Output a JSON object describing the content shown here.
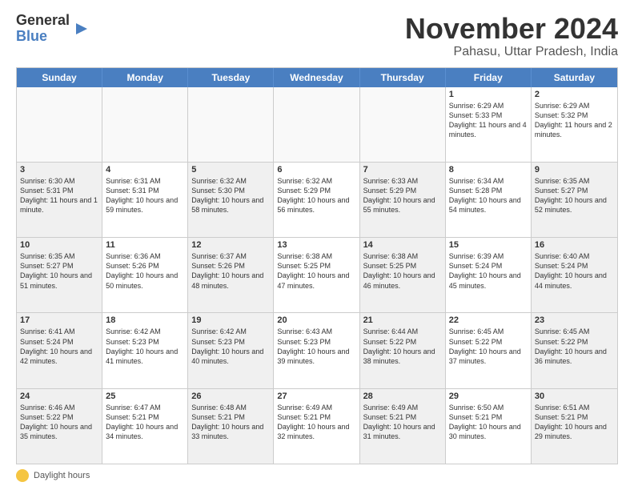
{
  "logo": {
    "line1": "General",
    "line2": "Blue"
  },
  "title": "November 2024",
  "subtitle": "Pahasu, Uttar Pradesh, India",
  "header_days": [
    "Sunday",
    "Monday",
    "Tuesday",
    "Wednesday",
    "Thursday",
    "Friday",
    "Saturday"
  ],
  "footer_label": "Daylight hours",
  "weeks": [
    [
      {
        "day": "",
        "info": "",
        "shaded": true
      },
      {
        "day": "",
        "info": "",
        "shaded": true
      },
      {
        "day": "",
        "info": "",
        "shaded": true
      },
      {
        "day": "",
        "info": "",
        "shaded": true
      },
      {
        "day": "",
        "info": "",
        "shaded": true
      },
      {
        "day": "1",
        "info": "Sunrise: 6:29 AM\nSunset: 5:33 PM\nDaylight: 11 hours and 4 minutes.",
        "shaded": false
      },
      {
        "day": "2",
        "info": "Sunrise: 6:29 AM\nSunset: 5:32 PM\nDaylight: 11 hours and 2 minutes.",
        "shaded": false
      }
    ],
    [
      {
        "day": "3",
        "info": "Sunrise: 6:30 AM\nSunset: 5:31 PM\nDaylight: 11 hours and 1 minute.",
        "shaded": true
      },
      {
        "day": "4",
        "info": "Sunrise: 6:31 AM\nSunset: 5:31 PM\nDaylight: 10 hours and 59 minutes.",
        "shaded": false
      },
      {
        "day": "5",
        "info": "Sunrise: 6:32 AM\nSunset: 5:30 PM\nDaylight: 10 hours and 58 minutes.",
        "shaded": true
      },
      {
        "day": "6",
        "info": "Sunrise: 6:32 AM\nSunset: 5:29 PM\nDaylight: 10 hours and 56 minutes.",
        "shaded": false
      },
      {
        "day": "7",
        "info": "Sunrise: 6:33 AM\nSunset: 5:29 PM\nDaylight: 10 hours and 55 minutes.",
        "shaded": true
      },
      {
        "day": "8",
        "info": "Sunrise: 6:34 AM\nSunset: 5:28 PM\nDaylight: 10 hours and 54 minutes.",
        "shaded": false
      },
      {
        "day": "9",
        "info": "Sunrise: 6:35 AM\nSunset: 5:27 PM\nDaylight: 10 hours and 52 minutes.",
        "shaded": true
      }
    ],
    [
      {
        "day": "10",
        "info": "Sunrise: 6:35 AM\nSunset: 5:27 PM\nDaylight: 10 hours and 51 minutes.",
        "shaded": true
      },
      {
        "day": "11",
        "info": "Sunrise: 6:36 AM\nSunset: 5:26 PM\nDaylight: 10 hours and 50 minutes.",
        "shaded": false
      },
      {
        "day": "12",
        "info": "Sunrise: 6:37 AM\nSunset: 5:26 PM\nDaylight: 10 hours and 48 minutes.",
        "shaded": true
      },
      {
        "day": "13",
        "info": "Sunrise: 6:38 AM\nSunset: 5:25 PM\nDaylight: 10 hours and 47 minutes.",
        "shaded": false
      },
      {
        "day": "14",
        "info": "Sunrise: 6:38 AM\nSunset: 5:25 PM\nDaylight: 10 hours and 46 minutes.",
        "shaded": true
      },
      {
        "day": "15",
        "info": "Sunrise: 6:39 AM\nSunset: 5:24 PM\nDaylight: 10 hours and 45 minutes.",
        "shaded": false
      },
      {
        "day": "16",
        "info": "Sunrise: 6:40 AM\nSunset: 5:24 PM\nDaylight: 10 hours and 44 minutes.",
        "shaded": true
      }
    ],
    [
      {
        "day": "17",
        "info": "Sunrise: 6:41 AM\nSunset: 5:24 PM\nDaylight: 10 hours and 42 minutes.",
        "shaded": true
      },
      {
        "day": "18",
        "info": "Sunrise: 6:42 AM\nSunset: 5:23 PM\nDaylight: 10 hours and 41 minutes.",
        "shaded": false
      },
      {
        "day": "19",
        "info": "Sunrise: 6:42 AM\nSunset: 5:23 PM\nDaylight: 10 hours and 40 minutes.",
        "shaded": true
      },
      {
        "day": "20",
        "info": "Sunrise: 6:43 AM\nSunset: 5:23 PM\nDaylight: 10 hours and 39 minutes.",
        "shaded": false
      },
      {
        "day": "21",
        "info": "Sunrise: 6:44 AM\nSunset: 5:22 PM\nDaylight: 10 hours and 38 minutes.",
        "shaded": true
      },
      {
        "day": "22",
        "info": "Sunrise: 6:45 AM\nSunset: 5:22 PM\nDaylight: 10 hours and 37 minutes.",
        "shaded": false
      },
      {
        "day": "23",
        "info": "Sunrise: 6:45 AM\nSunset: 5:22 PM\nDaylight: 10 hours and 36 minutes.",
        "shaded": true
      }
    ],
    [
      {
        "day": "24",
        "info": "Sunrise: 6:46 AM\nSunset: 5:22 PM\nDaylight: 10 hours and 35 minutes.",
        "shaded": true
      },
      {
        "day": "25",
        "info": "Sunrise: 6:47 AM\nSunset: 5:21 PM\nDaylight: 10 hours and 34 minutes.",
        "shaded": false
      },
      {
        "day": "26",
        "info": "Sunrise: 6:48 AM\nSunset: 5:21 PM\nDaylight: 10 hours and 33 minutes.",
        "shaded": true
      },
      {
        "day": "27",
        "info": "Sunrise: 6:49 AM\nSunset: 5:21 PM\nDaylight: 10 hours and 32 minutes.",
        "shaded": false
      },
      {
        "day": "28",
        "info": "Sunrise: 6:49 AM\nSunset: 5:21 PM\nDaylight: 10 hours and 31 minutes.",
        "shaded": true
      },
      {
        "day": "29",
        "info": "Sunrise: 6:50 AM\nSunset: 5:21 PM\nDaylight: 10 hours and 30 minutes.",
        "shaded": false
      },
      {
        "day": "30",
        "info": "Sunrise: 6:51 AM\nSunset: 5:21 PM\nDaylight: 10 hours and 29 minutes.",
        "shaded": true
      }
    ]
  ]
}
